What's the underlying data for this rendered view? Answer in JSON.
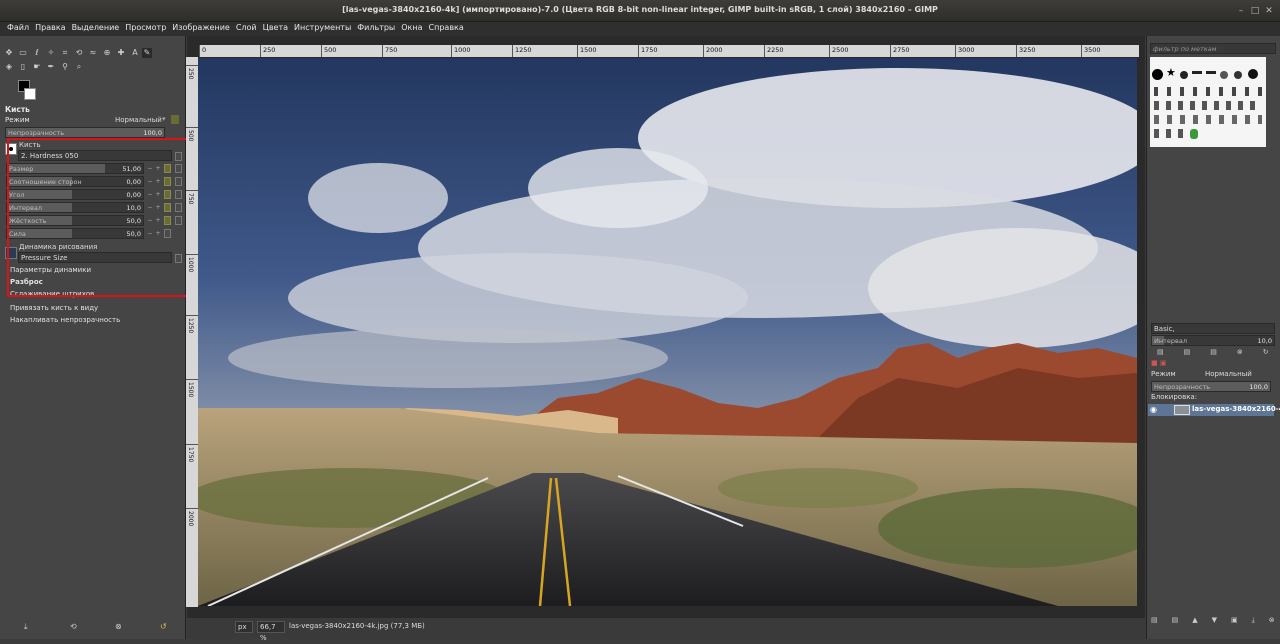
{
  "window": {
    "title": "[las-vegas-3840x2160-4k] (импортировано)-7.0 (Цвета RGB 8-bit non-linear integer, GIMP built-in sRGB, 1 слой) 3840x2160 – GIMP"
  },
  "menu": [
    "Файл",
    "Правка",
    "Выделение",
    "Просмотр",
    "Изображение",
    "Слой",
    "Цвета",
    "Инструменты",
    "Фильтры",
    "Окна",
    "Справка"
  ],
  "tool_options": {
    "title": "Кисть",
    "mode_label": "Режим",
    "mode_value": "Нормальный",
    "opacity_label": "Непрозрачность",
    "opacity_value": "100,0",
    "brush_label": "Кисть",
    "brush_name": "2. Hardness 050",
    "size_label": "Размер",
    "size_value": "51,00",
    "aspect_label": "Соотношение сторон",
    "aspect_value": "0,00",
    "angle_label": "Угол",
    "angle_value": "0,00",
    "spacing_label": "Интервал",
    "spacing_value": "10,0",
    "hardness_label": "Жёсткость",
    "hardness_value": "50,0",
    "force_label": "Сила",
    "force_value": "50,0",
    "dynamics_label": "Динамика рисования",
    "dynamics_value": "Pressure Size",
    "dynamics_options": "Параметры динамики",
    "scatter": "Разброс",
    "smooth": "Сглаживание штрихов",
    "lock_brush": "Привязать кисть к виду",
    "incremental": "Накапливать непрозрачность"
  },
  "ruler_ticks": [
    "0",
    "250",
    "500",
    "750",
    "1000",
    "1250",
    "1500",
    "1750",
    "2000",
    "2250",
    "2500",
    "2750",
    "3000",
    "3250",
    "3500"
  ],
  "vruler_ticks": [
    "250",
    "500",
    "750",
    "1000",
    "1250",
    "1500",
    "1750",
    "2000"
  ],
  "status": {
    "unit": "px",
    "zoom": "66,7 %",
    "file": "las-vegas-3840x2160-4k.jpg (77,3 МБ)"
  },
  "right_dock": {
    "filter_placeholder": "фильтр по меткам",
    "brush_preset": "Basic,",
    "spacing_label": "Интервал",
    "spacing_value": "10,0",
    "layers_mode_label": "Режим",
    "layers_mode_value": "Нормальный",
    "layers_opacity_label": "Непрозрачность",
    "layers_opacity_value": "100,0",
    "lock_label": "Блокировка:",
    "layer_name": "las-vegas-3840x2160-4k.jpg"
  },
  "colors": {
    "highlight_box": "#e0101b",
    "selected_layer": "#5d7696"
  }
}
